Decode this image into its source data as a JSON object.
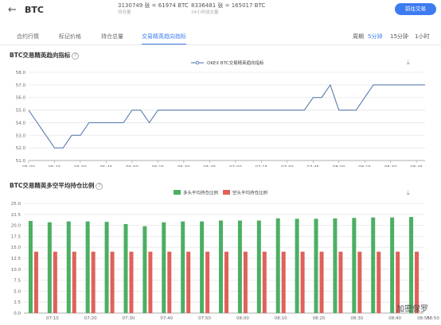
{
  "header": {
    "back_icon": "arrow-left-icon",
    "title": "BTC",
    "stat1_value": "3130749 张 = 61974 BTC",
    "stat1_label": "持仓量",
    "stat2_value": "8336481 张 = 165017 BTC",
    "stat2_label": "24小时成交量",
    "action_button": "前往交易"
  },
  "tabs": [
    {
      "label": "合约行情",
      "active": false
    },
    {
      "label": "标记价格",
      "active": false
    },
    {
      "label": "持仓总量",
      "active": false
    },
    {
      "label": "交易精英趋向指标",
      "active": true
    }
  ],
  "intervals": [
    {
      "label": "周期",
      "active": false
    },
    {
      "label": "5分钟",
      "active": true
    },
    {
      "label": "15分钟",
      "active": false
    },
    {
      "label": "1小时",
      "active": false
    }
  ],
  "chart1_title": "BTC交易精英趋向指标",
  "chart2_title": "BTC交易精英多空平均持仓比例",
  "watermark": "加密保罗",
  "chart_data": [
    {
      "type": "line",
      "title": "BTC交易精英趋向指标",
      "legend": [
        "OKEX BTC交易精英趋向指标"
      ],
      "legend_position": "top-center",
      "grid": true,
      "ylim": [
        51.0,
        58.0
      ],
      "yticks": [
        "51.0",
        "52.0",
        "53.0",
        "54.0",
        "55.0",
        "56.0",
        "57.0",
        "58.0"
      ],
      "xticks": [
        "05:00",
        "05:15",
        "05:30",
        "05:45",
        "06:00",
        "06:15",
        "06:30",
        "06:45",
        "07:00",
        "07:15",
        "07:30",
        "07:45",
        "08:00",
        "08:15",
        "08:30",
        "08:45"
      ],
      "series": [
        {
          "name": "OKEX BTC交易精英趋向指标",
          "color": "#4a6fa5",
          "x": [
            "05:00",
            "05:05",
            "05:10",
            "05:15",
            "05:20",
            "05:25",
            "05:30",
            "05:35",
            "05:40",
            "05:45",
            "05:50",
            "05:55",
            "06:00",
            "06:05",
            "06:10",
            "06:15",
            "06:20",
            "06:25",
            "06:30",
            "06:35",
            "06:40",
            "06:45",
            "06:50",
            "06:55",
            "07:00",
            "07:05",
            "07:10",
            "07:15",
            "07:20",
            "07:25",
            "07:30",
            "07:35",
            "07:40",
            "07:45",
            "07:50",
            "07:55",
            "08:00",
            "08:05",
            "08:10",
            "08:15",
            "08:20",
            "08:25",
            "08:30",
            "08:35",
            "08:40",
            "08:45",
            "08:50"
          ],
          "values": [
            55,
            54,
            53,
            52,
            52,
            53,
            53,
            54,
            54,
            54,
            54,
            54,
            55,
            55,
            54,
            55,
            55,
            55,
            55,
            55,
            55,
            55,
            55,
            55,
            55,
            55,
            55,
            55,
            55,
            55,
            55,
            55,
            55,
            56,
            56,
            57,
            55,
            55,
            55,
            56,
            57,
            57,
            57,
            57,
            57,
            57,
            57
          ]
        }
      ]
    },
    {
      "type": "bar",
      "title": "BTC交易精英多空平均持仓比例",
      "legend_position": "top-center",
      "grid": true,
      "ylim": [
        0.0,
        25.0
      ],
      "yticks": [
        "0.0",
        "2.5",
        "5.0",
        "7.5",
        "10.0",
        "12.5",
        "15.0",
        "17.5",
        "20.0",
        "22.5",
        "25.0"
      ],
      "xticks": [
        "07:10",
        "07:20",
        "07:30",
        "07:40",
        "07:50",
        "08:00",
        "08:10",
        "08:20",
        "08:30",
        "08:40",
        "08:50",
        "08:55"
      ],
      "categories": [
        "07:05",
        "07:10",
        "07:15",
        "07:20",
        "07:25",
        "07:30",
        "07:35",
        "07:40",
        "07:45",
        "07:50",
        "07:55",
        "08:00",
        "08:05",
        "08:10",
        "08:15",
        "08:20",
        "08:25",
        "08:30",
        "08:35",
        "08:40",
        "08:45"
      ],
      "series": [
        {
          "name": "多头平均持仓比例",
          "color": "#4caf64",
          "values": [
            21.0,
            20.7,
            20.9,
            20.9,
            20.8,
            20.3,
            19.8,
            20.7,
            20.9,
            20.9,
            21.1,
            21.1,
            21.1,
            21.6,
            21.5,
            21.5,
            21.6,
            21.7,
            21.8,
            21.8,
            21.9
          ]
        },
        {
          "name": "空头平均持仓比例",
          "color": "#e0615a",
          "values": [
            14,
            14,
            14,
            14,
            14,
            14,
            14,
            14,
            14,
            14,
            14,
            14,
            14,
            14,
            14,
            14,
            14,
            14,
            14,
            14,
            14
          ]
        }
      ]
    }
  ]
}
